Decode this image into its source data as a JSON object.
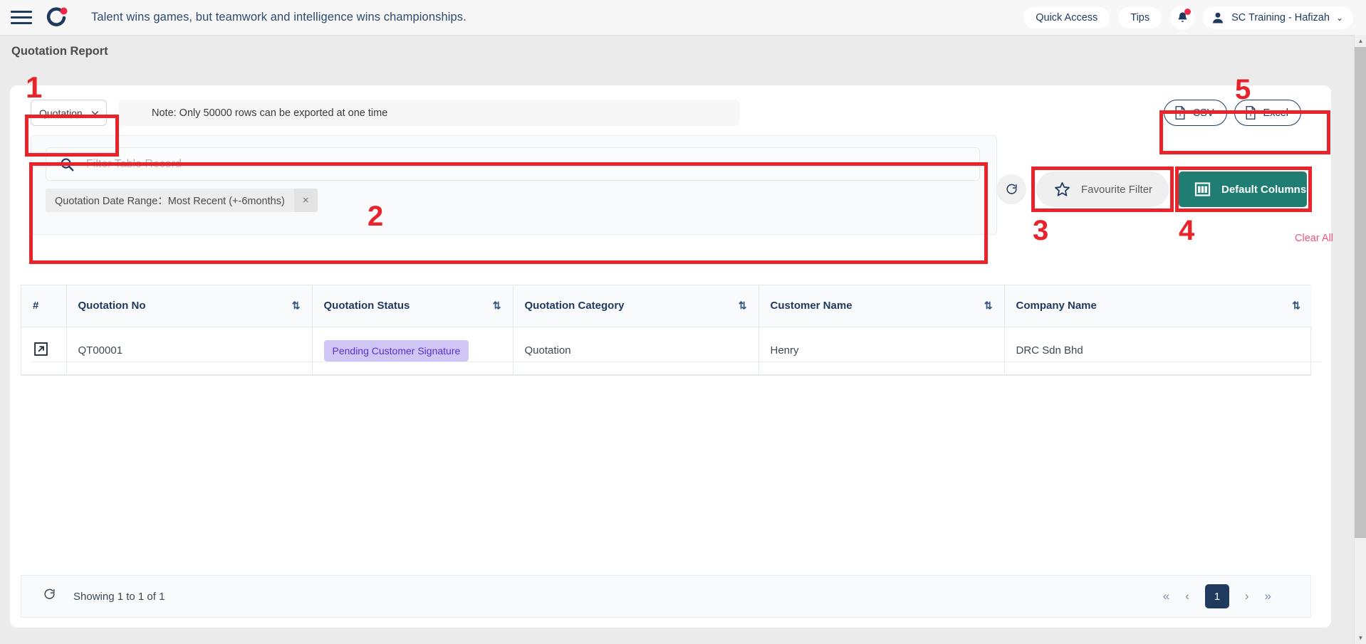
{
  "topbar": {
    "menu_icon": "hamburger-icon",
    "logo_icon": "brand-logo-icon",
    "headline": "Talent wins games, but teamwork and intelligence wins championships.",
    "quick_access_label": "Quick Access",
    "tips_label": "Tips",
    "bell_icon": "notification-bell-icon",
    "user_name": "SC Training - Hafizah",
    "user_caret": "⌄"
  },
  "page": {
    "title": "Quotation Report"
  },
  "toolbar": {
    "module_select_value": "Quotation",
    "module_select_caret": "⌄",
    "note": "Note: Only 50000 rows can be exported at one time",
    "csv_label": "CSV",
    "excel_label": "Excel"
  },
  "filters": {
    "search_placeholder": "Filter Table Record",
    "search_value": "",
    "search_icon": "search-icon",
    "refresh_icon": "refresh-icon",
    "chips": [
      {
        "label": "Quotation Date Range：Most Recent (+-6months)",
        "close": "×"
      }
    ],
    "favourite_filter_label": "Favourite Filter",
    "favourite_filter_icon": "star-icon",
    "default_columns_label": "Default Columns",
    "default_columns_icon": "columns-icon",
    "clear_all_label": "Clear All"
  },
  "table": {
    "sort_icon": "⇅",
    "open_icon": "external-link-icon",
    "columns": [
      {
        "key": "hash",
        "label": "#",
        "sortable": false
      },
      {
        "key": "no",
        "label": "Quotation No",
        "sortable": true
      },
      {
        "key": "status",
        "label": "Quotation Status",
        "sortable": true
      },
      {
        "key": "category",
        "label": "Quotation Category",
        "sortable": true
      },
      {
        "key": "customer",
        "label": "Customer Name",
        "sortable": true
      },
      {
        "key": "company",
        "label": "Company Name",
        "sortable": true
      }
    ],
    "rows": [
      {
        "no": "QT00001",
        "status": "Pending Customer Signature",
        "category": "Quotation",
        "customer": "Henry",
        "company": "DRC Sdn Bhd"
      }
    ]
  },
  "footer": {
    "refresh_icon": "refresh-icon",
    "showing": "Showing 1 to 1 of 1",
    "first": "«",
    "prev": "‹",
    "current_page": "1",
    "next": "›",
    "last": "»"
  },
  "annotations": [
    {
      "number": "1"
    },
    {
      "number": "2"
    },
    {
      "number": "3"
    },
    {
      "number": "4"
    },
    {
      "number": "5"
    }
  ],
  "colors": {
    "accent_red": "#e8242a",
    "brand_navy": "#1e3a5f",
    "teal_button": "#1f7d71",
    "badge_bg": "#cfc6f5",
    "badge_text": "#5b2fd4",
    "clear_all": "#f2547a"
  }
}
